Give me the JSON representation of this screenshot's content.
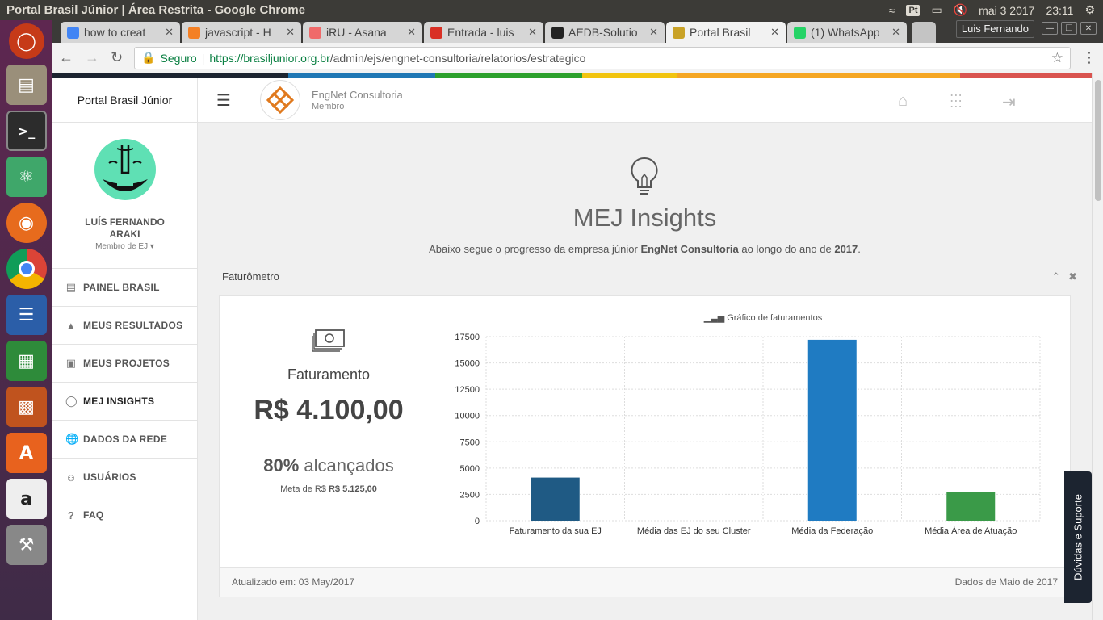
{
  "os": {
    "window_title": "Portal Brasil Júnior | Área Restrita - Google Chrome",
    "lang_indicator": "Pt",
    "date": "mai 3 2017",
    "time": "23:11"
  },
  "launcher": [
    "ubuntu-icon",
    "files-icon",
    "terminal-icon",
    "atom-icon",
    "firefox-icon",
    "chrome-icon",
    "writer-icon",
    "calc-icon",
    "impress-icon",
    "software-center-icon",
    "amazon-icon",
    "settings-icon",
    "trash-icon"
  ],
  "browser": {
    "tabs": [
      {
        "label": "how to creat",
        "icon": "google-icon",
        "color": "#4285f4",
        "active": false
      },
      {
        "label": "javascript - H",
        "icon": "stackoverflow-icon",
        "color": "#f48024",
        "active": false
      },
      {
        "label": "iRU - Asana",
        "icon": "asana-icon",
        "color": "#f06a6a",
        "active": false
      },
      {
        "label": "Entrada - luis",
        "icon": "gmail-icon",
        "color": "#d93025",
        "active": false
      },
      {
        "label": "AEDB-Solutio",
        "icon": "github-icon",
        "color": "#222222",
        "active": false
      },
      {
        "label": "Portal Brasil",
        "icon": "loading-icon",
        "color": "#c9a227",
        "active": true
      },
      {
        "label": "(1) WhatsApp",
        "icon": "whatsapp-icon",
        "color": "#25d366",
        "active": false
      }
    ],
    "profile_name": "Luis Fernando",
    "secure_label": "Seguro",
    "url_host": "https://brasiljunior.org.br",
    "url_path": "/admin/ejs/engnet-consultoria/relatorios/estrategico"
  },
  "colors": {
    "brand_bar": [
      "#1c2430",
      "#1f77b4",
      "#2ca02c",
      "#f1c40f",
      "#f5a623",
      "#d9534f"
    ],
    "bar_dark": "#1f5a84",
    "bar_blue": "#1f7bc2",
    "bar_green": "#3a9a48"
  },
  "sidebar": {
    "brand": "Portal Brasil Júnior",
    "user_name": "LUÍS FERNANDO ARAKI",
    "user_role": "Membro de EJ",
    "items": [
      {
        "label": "PAINEL BRASIL",
        "icon": "dashboard-icon",
        "active": false
      },
      {
        "label": "MEUS RESULTADOS",
        "icon": "rocket-icon",
        "active": false
      },
      {
        "label": "MEUS PROJETOS",
        "icon": "briefcase-icon",
        "active": false
      },
      {
        "label": "MEJ INSIGHTS",
        "icon": "lightbulb-icon",
        "active": true
      },
      {
        "label": "DADOS DA REDE",
        "icon": "globe-icon",
        "active": false
      },
      {
        "label": "USUÁRIOS",
        "icon": "users-icon",
        "active": false
      },
      {
        "label": "FAQ",
        "icon": "question-icon",
        "active": false
      }
    ]
  },
  "header": {
    "ej_name": "EngNet Consultoria",
    "ej_role": "Membro"
  },
  "main": {
    "title": "MEJ Insights",
    "subtitle_pre": "Abaixo segue o progresso da empresa júnior ",
    "subtitle_ej": "EngNet Consultoria",
    "subtitle_mid": " ao longo do ano de ",
    "subtitle_year": "2017",
    "subtitle_end": ".",
    "panel_title": "Faturômetro",
    "fat_label": "Faturamento",
    "fat_value": "R$ 4.100,00",
    "fat_pct": "80%",
    "fat_pct_suffix": " alcançados",
    "meta_label": "Meta de R$ ",
    "meta_value": "R$ 5.125,00",
    "updated": "Atualizado em: 03 May/2017",
    "data_ref": "Dados de Maio de 2017"
  },
  "chart_data": {
    "type": "bar",
    "title": "Gráfico de faturamentos",
    "categories": [
      "Faturamento da sua EJ",
      "Média das EJ do seu Cluster",
      "Média da Federação",
      "Média Área de Atuação"
    ],
    "values": [
      4100,
      0,
      17200,
      2700
    ],
    "colors": [
      "#1f5a84",
      "#1f5a84",
      "#1f7bc2",
      "#3a9a48"
    ],
    "yticks": [
      0,
      2500,
      5000,
      7500,
      10000,
      12500,
      15000,
      17500
    ],
    "ylim": [
      0,
      17500
    ],
    "grid": true
  },
  "support_label": "Dúvidas e Suporte"
}
